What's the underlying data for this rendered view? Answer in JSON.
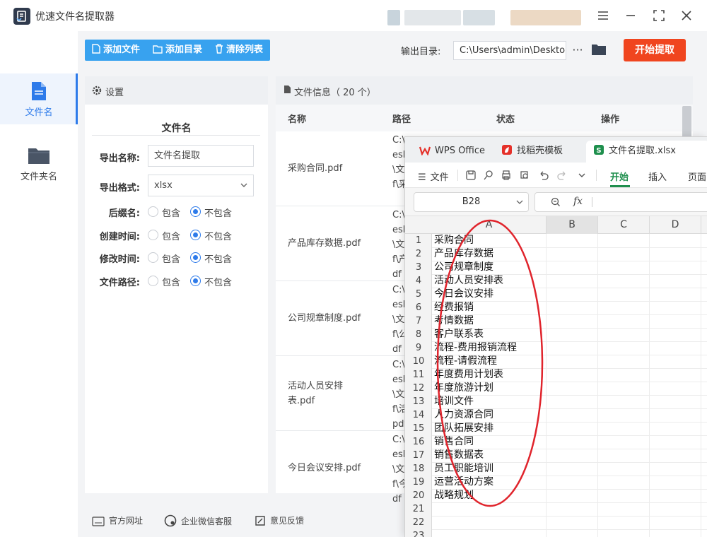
{
  "app": {
    "title": "优速文件名提取器"
  },
  "window_controls": {
    "menu": "menu-icon",
    "maximize": "maximize-icon",
    "close": "close-icon"
  },
  "sidebar": {
    "items": [
      {
        "label": "文件名",
        "icon": "file-icon",
        "active": true
      },
      {
        "label": "文件夹名",
        "icon": "folder-icon",
        "active": false
      }
    ]
  },
  "toolbar": {
    "add_file": "添加文件",
    "add_dir": "添加目录",
    "clear": "清除列表",
    "output_label": "输出目录:",
    "output_path": "C:\\Users\\admin\\Deskto",
    "more": "···",
    "start": "开始提取"
  },
  "settings": {
    "title": "设置",
    "section": "文件名",
    "export_name_label": "导出名称:",
    "export_name_value": "文件名提取",
    "export_format_label": "导出格式:",
    "export_format_value": "xlsx",
    "include_text": "包含",
    "exclude_text": "不包含",
    "options": [
      {
        "label": "后缀名:",
        "selected": "exclude"
      },
      {
        "label": "创建时间:",
        "selected": "exclude"
      },
      {
        "label": "修改时间:",
        "selected": "exclude"
      },
      {
        "label": "文件路径:",
        "selected": "exclude"
      }
    ]
  },
  "file_panel": {
    "title": "文件信息（ 20 个）",
    "columns": [
      "名称",
      "路径",
      "状态",
      "操作"
    ],
    "rows": [
      {
        "name": "采购合同.pdf",
        "path": [
          "C:\\",
          "esk",
          "\\文",
          "f\\采"
        ]
      },
      {
        "name": "产品库存数据.pdf",
        "path": [
          "C:\\",
          "esk",
          "\\文",
          "f\\产",
          "df"
        ]
      },
      {
        "name": "公司规章制度.pdf",
        "path": [
          "C:\\",
          "esk",
          "\\文",
          "f\\公",
          "df"
        ]
      },
      {
        "name": "活动人员安排表.pdf",
        "path": [
          "C:\\",
          "esk",
          "\\文",
          "f\\活",
          "pdf"
        ]
      },
      {
        "name": "今日会议安排.pdf",
        "path": [
          "C:\\",
          "esk",
          "\\文",
          "f\\今",
          "df"
        ]
      }
    ]
  },
  "footer": {
    "website": "官方网址",
    "wechat": "企业微信客服",
    "feedback": "意见反馈"
  },
  "wps": {
    "tabs": [
      {
        "label": "WPS Office"
      },
      {
        "label": "找稻壳模板"
      },
      {
        "label": "文件名提取.xlsx"
      }
    ],
    "ribbon": {
      "file": "文件",
      "tabs": [
        "开始",
        "插入",
        "页面"
      ]
    },
    "cell_ref": "B28",
    "fx": "fx",
    "columns": [
      "A",
      "B",
      "C",
      "D"
    ],
    "rows": [
      "采购合同",
      "产品库存数据",
      "公司规章制度",
      "活动人员安排表",
      "今日会议安排",
      "经费报销",
      "考情数据",
      "客户联系表",
      "流程-费用报销流程",
      "流程-请假流程",
      "年度费用计划表",
      "年度旅游计划",
      "培训文件",
      "人力资源合同",
      "团队拓展安排",
      "销售合同",
      "销售数据表",
      "员工职能培训",
      "运营活动方案",
      "战略规划",
      "",
      "",
      ""
    ],
    "colors": {
      "active_tab_accent": "#1e8f4d",
      "highlight_oval": "#e0242c"
    }
  },
  "colors": {
    "accent": "#2e7bea",
    "toolbar_blue": "#38a2ef",
    "start_red": "#f0451f"
  }
}
